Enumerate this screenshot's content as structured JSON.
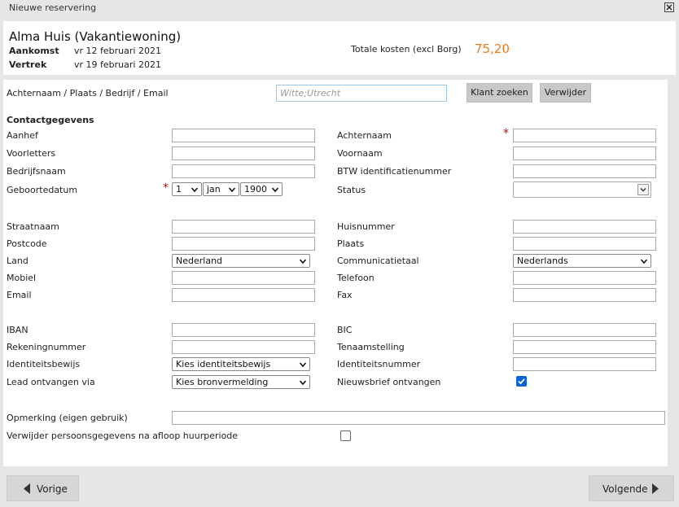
{
  "window": {
    "title": "Nieuwe reservering"
  },
  "reservation": {
    "property": "Alma Huis (Vakantiewoning)",
    "arrival_label": "Aankomst",
    "arrival_value": "vr 12 februari 2021",
    "departure_label": "Vertrek",
    "departure_value": "vr 19 februari 2021",
    "total_label": "Totale kosten (excl Borg)",
    "total_value": "75,20"
  },
  "search": {
    "label": "Achternaam / Plaats / Bedrijf / Email",
    "placeholder": "Witte;Utrecht",
    "find_button": "Klant zoeken",
    "remove_button": "Verwijder"
  },
  "contact": {
    "section_title": "Contactgegevens",
    "aanhef": "Aanhef",
    "achternaam": "Achternaam",
    "voorletters": "Voorletters",
    "voornaam": "Voornaam",
    "bedrijfsnaam": "Bedrijfsnaam",
    "btw": "BTW identificatienummer",
    "geboortedatum": "Geboortedatum",
    "status": "Status",
    "birth_day": "1",
    "birth_month": "jan",
    "birth_year": "1900",
    "status_value": ""
  },
  "address": {
    "straatnaam": "Straatnaam",
    "huisnummer": "Huisnummer",
    "postcode": "Postcode",
    "plaats": "Plaats",
    "land": "Land",
    "land_value": "Nederland",
    "communicatietaal": "Communicatietaal",
    "communicatietaal_value": "Nederlands",
    "mobiel": "Mobiel",
    "telefoon": "Telefoon",
    "email": "Email",
    "fax": "Fax"
  },
  "bank": {
    "iban": "IBAN",
    "bic": "BIC",
    "rekeningnummer": "Rekeningnummer",
    "tenaamstelling": "Tenaamstelling",
    "identiteitsbewijs": "Identiteitsbewijs",
    "identiteitsbewijs_value": "Kies identiteitsbewijs",
    "identiteitsnummer": "Identiteitsnummer",
    "lead": "Lead ontvangen via",
    "lead_value": "Kies bronvermelding",
    "nieuwsbrief": "Nieuwsbrief ontvangen",
    "nieuwsbrief_checked": true
  },
  "extra": {
    "opmerking": "Opmerking (eigen gebruik)",
    "verwijder": "Verwijder persoonsgegevens na afloop huurperiode",
    "verwijder_checked": false
  },
  "nav": {
    "prev": "Vorige",
    "next": "Volgende"
  },
  "colors": {
    "accent": "#f07a1a",
    "required": "#e00000",
    "checkbox": "#0a64d8"
  }
}
